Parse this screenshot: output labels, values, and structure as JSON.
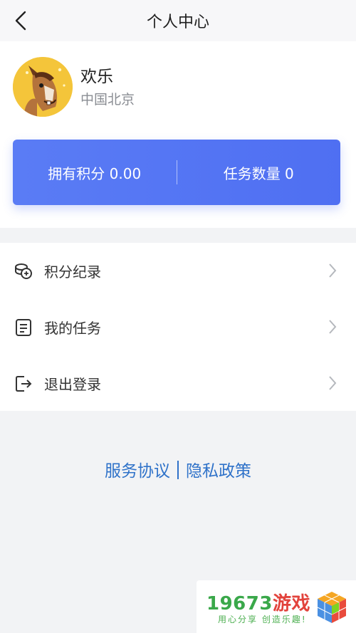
{
  "header": {
    "title": "个人中心",
    "back_icon": "chevron-left-icon"
  },
  "profile": {
    "name": "欢乐",
    "location": "中国北京",
    "avatar_icon": "horse-avatar"
  },
  "stats": {
    "points_label": "拥有积分 0.00",
    "tasks_label": "任务数量 0",
    "accent_color": "#5374f3"
  },
  "menu": {
    "items": [
      {
        "label": "积分纪录",
        "icon": "coins-icon"
      },
      {
        "label": "我的任务",
        "icon": "document-icon"
      },
      {
        "label": "退出登录",
        "icon": "logout-icon"
      }
    ]
  },
  "footer": {
    "terms": "服务协议",
    "privacy": "隐私政策",
    "link_color": "#2f72c9"
  },
  "watermark": {
    "number": "19673",
    "name": "游戏",
    "slogan": "用心分享 创造乐趣!"
  }
}
